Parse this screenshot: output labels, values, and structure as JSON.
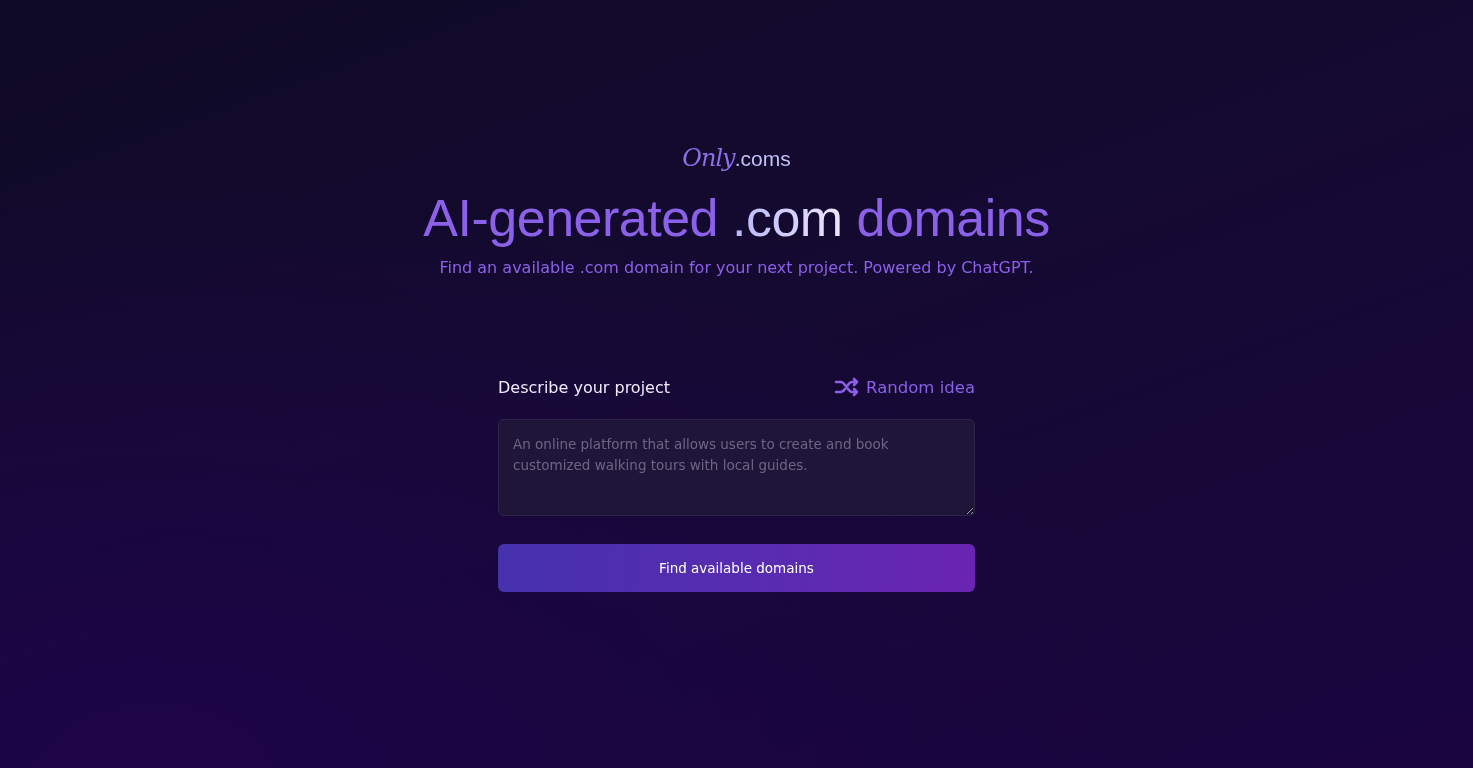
{
  "logo": {
    "script": "Only",
    "suffix": ".coms"
  },
  "headline": [
    {
      "text": "AI-generated",
      "kind": "accent"
    },
    {
      "text": ".com",
      "kind": "highlight"
    },
    {
      "text": "domains",
      "kind": "accent"
    }
  ],
  "subtitle": "Find an available .com domain for your next project. Powered by ChatGPT.",
  "form": {
    "label": "Describe your project",
    "random_link": "Random idea",
    "placeholder": "An online platform that allows users to create and book customized walking tours with local guides.",
    "submit": "Find available domains"
  }
}
